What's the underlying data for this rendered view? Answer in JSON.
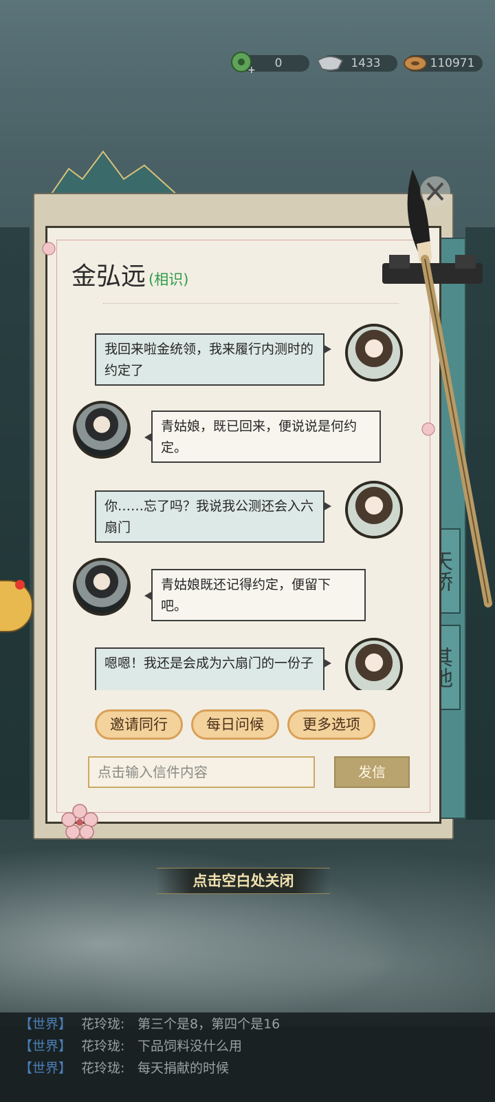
{
  "currency": {
    "jade": {
      "icon": "jade-coin-icon",
      "value": "0"
    },
    "silver": {
      "icon": "silver-ingot-icon",
      "value": "1433"
    },
    "copper": {
      "icon": "copper-coins-icon",
      "value": "110971"
    }
  },
  "letter": {
    "contact_name": "金弘远",
    "relation": "(相识)"
  },
  "side_tabs": [
    "天桥",
    "其他"
  ],
  "messages": [
    {
      "from": "me",
      "text": "我回来啦金统领，我来履行内测时的约定了"
    },
    {
      "from": "npc",
      "text": "青姑娘，既已回来，便说说是何约定。"
    },
    {
      "from": "me",
      "text": "你……忘了吗？我说我公测还会入六扇门"
    },
    {
      "from": "npc",
      "text": "青姑娘既还记得约定，便留下吧。"
    },
    {
      "from": "me",
      "text": "嗯嗯！我还是会成为六扇门的一份子"
    }
  ],
  "options": {
    "invite": "邀请同行",
    "daily": "每日问候",
    "more": "更多选项"
  },
  "compose": {
    "placeholder": "点击输入信件内容",
    "send": "发信"
  },
  "close_hint": "点击空白处关闭",
  "world_chat": [
    {
      "channel": "【世界】",
      "name": "花玲珑:",
      "text": "第三个是8，第四个是16"
    },
    {
      "channel": "【世界】",
      "name": "花玲珑:",
      "text": "下品饲料没什么用"
    },
    {
      "channel": "【世界】",
      "name": "花玲珑:",
      "text": "每天捐献的时候"
    }
  ],
  "colors": {
    "relation": "#2f9c4a",
    "channel": "#4b7fb8",
    "option_fill": "#f3d29b"
  }
}
